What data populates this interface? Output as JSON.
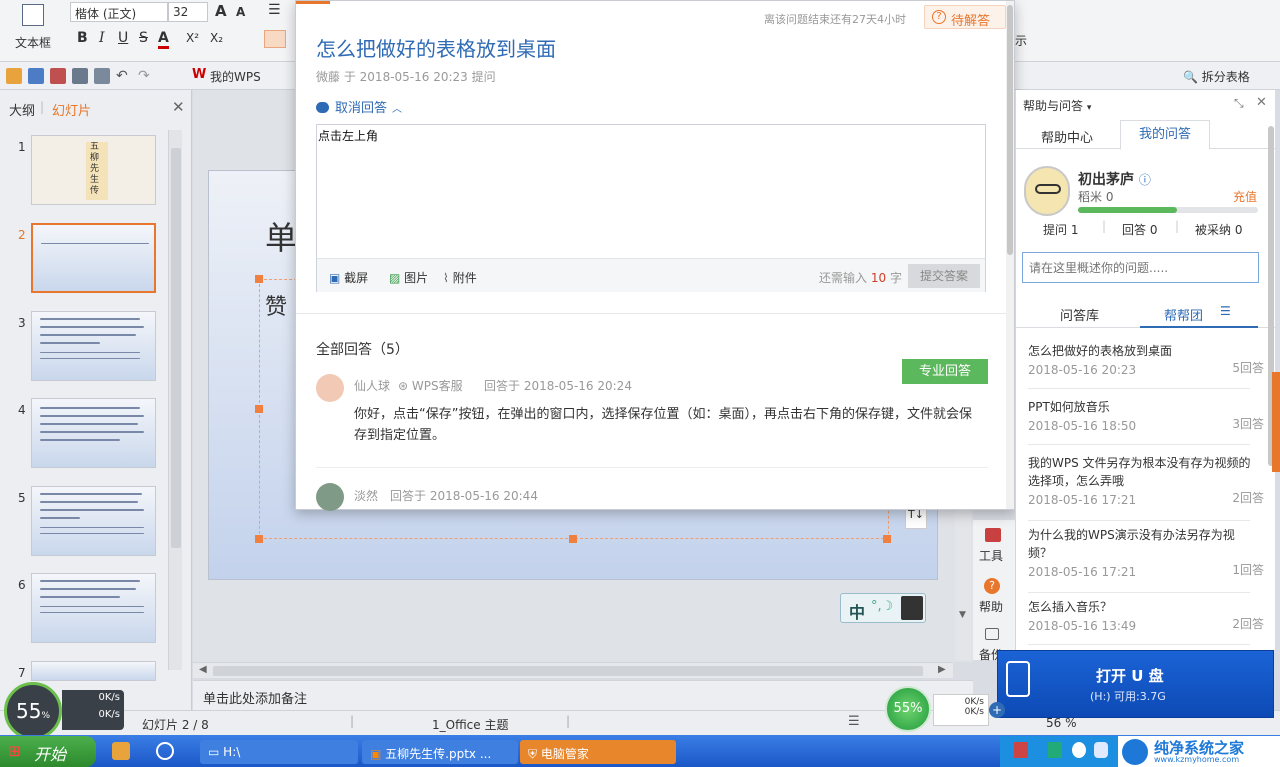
{
  "ribbon": {
    "textbox_label": "文本框",
    "font_name": "楷体 (正文)",
    "font_size": "32",
    "grow_font": "A",
    "shrink_font": "A",
    "bold": "B",
    "italic": "I",
    "underline": "U",
    "strike": "S",
    "font_color": "A",
    "superscript": "X²",
    "subscript": "X₂",
    "right_cut_label": "示",
    "split_table": "拆分表格"
  },
  "quickbar": {
    "my_wps": "我的WPS"
  },
  "left_panel": {
    "tab_outline": "大纲",
    "tab_slides": "幻灯片",
    "thumbs": [
      {
        "num": "1",
        "title_text": "五柳先生传"
      },
      {
        "num": "2"
      },
      {
        "num": "3"
      },
      {
        "num": "4"
      },
      {
        "num": "5"
      },
      {
        "num": "6"
      },
      {
        "num": "7"
      }
    ]
  },
  "slide": {
    "title_partial": "单",
    "body_partial": "赞"
  },
  "notes_placeholder": "单击此处添加备注",
  "statusbar": {
    "slide_info": "幻灯片 2 / 8",
    "theme": "1_Office 主题",
    "zoom": "56 %"
  },
  "popup": {
    "timer_text": "离该问题结束还有27天4小时",
    "status_badge": "待解答",
    "question_title": "怎么把做好的表格放到桌面",
    "asker": "微藤",
    "asked_meta": "于 2018-05-16 20:23 提问",
    "cancel_answer": "取消回答",
    "answer_text": "点击左上角",
    "tool_screenshot": "截屏",
    "tool_image": "图片",
    "tool_attachment": "附件",
    "remaining_prefix": "还需输入",
    "remaining_count": "10",
    "remaining_suffix": "字",
    "submit": "提交答案",
    "all_answers": "全部回答（5）",
    "answers": [
      {
        "user": "仙人球",
        "role": "WPS客服",
        "meta": "回答于 2018-05-16 20:24",
        "badge": "专业回答",
        "text": "你好，点击“保存”按钮，在弹出的窗口内，选择保存位置（如：桌面），再点击右下角的保存键，文件就会保存到指定位置。"
      },
      {
        "user": "淡然",
        "meta": "回答于 2018-05-16 20:44"
      }
    ]
  },
  "right_panel": {
    "header": "帮助与问答",
    "tab_help_center": "帮助中心",
    "tab_my_answers": "我的问答",
    "username": "初出茅庐",
    "points": "稻米 0",
    "recharge": "充值",
    "progress": 0.55,
    "stats": [
      "提问 1",
      "回答 0",
      "被采纳 0"
    ],
    "ask_placeholder": "请在这里概述你的问题.....",
    "tab_library": "问答库",
    "tab_helpgroup": "帮帮团",
    "questions": [
      {
        "title": "怎么把做好的表格放到桌面",
        "date": "2018-05-16 20:23",
        "count": "5回答"
      },
      {
        "title": "PPT如何放音乐",
        "date": "2018-05-16 18:50",
        "count": "3回答"
      },
      {
        "title": "我的WPS 文件另存为根本没有存为视频的选择项，怎么弄哦",
        "date": "2018-05-16 17:21",
        "count": "2回答"
      },
      {
        "title": "为什么我的WPS演示没有办法另存为视频？",
        "date": "2018-05-16 17:21",
        "count": "1回答"
      },
      {
        "title": "怎么插入音乐？",
        "date": "2018-05-16 13:49",
        "count": "2回答"
      }
    ]
  },
  "side_tools": {
    "tools": "工具",
    "help": "帮助",
    "backup": "备份"
  },
  "ime_bar": {
    "lang": "中"
  },
  "usb_popup": {
    "title": "打开 U 盘",
    "sub": "(H:)  可用:3.7G"
  },
  "net_widget": {
    "percent": "55%",
    "up": "0K/s",
    "down": "0K/s"
  },
  "left_widget": {
    "percent": "55",
    "unit": "%",
    "up": "0K/s",
    "down": "0K/s"
  },
  "taskbar": {
    "start": "开始",
    "items": [
      "H:\\",
      "五柳先生传.pptx ...",
      "电脑管家"
    ],
    "brand": "纯净系统之家",
    "brand_url": "www.kzmyhome.com"
  },
  "colors": {
    "accent_orange": "#e8762c",
    "link_blue": "#2f6bb5",
    "green_badge": "#5cb85c",
    "taskbar_blue": "#245edb"
  }
}
